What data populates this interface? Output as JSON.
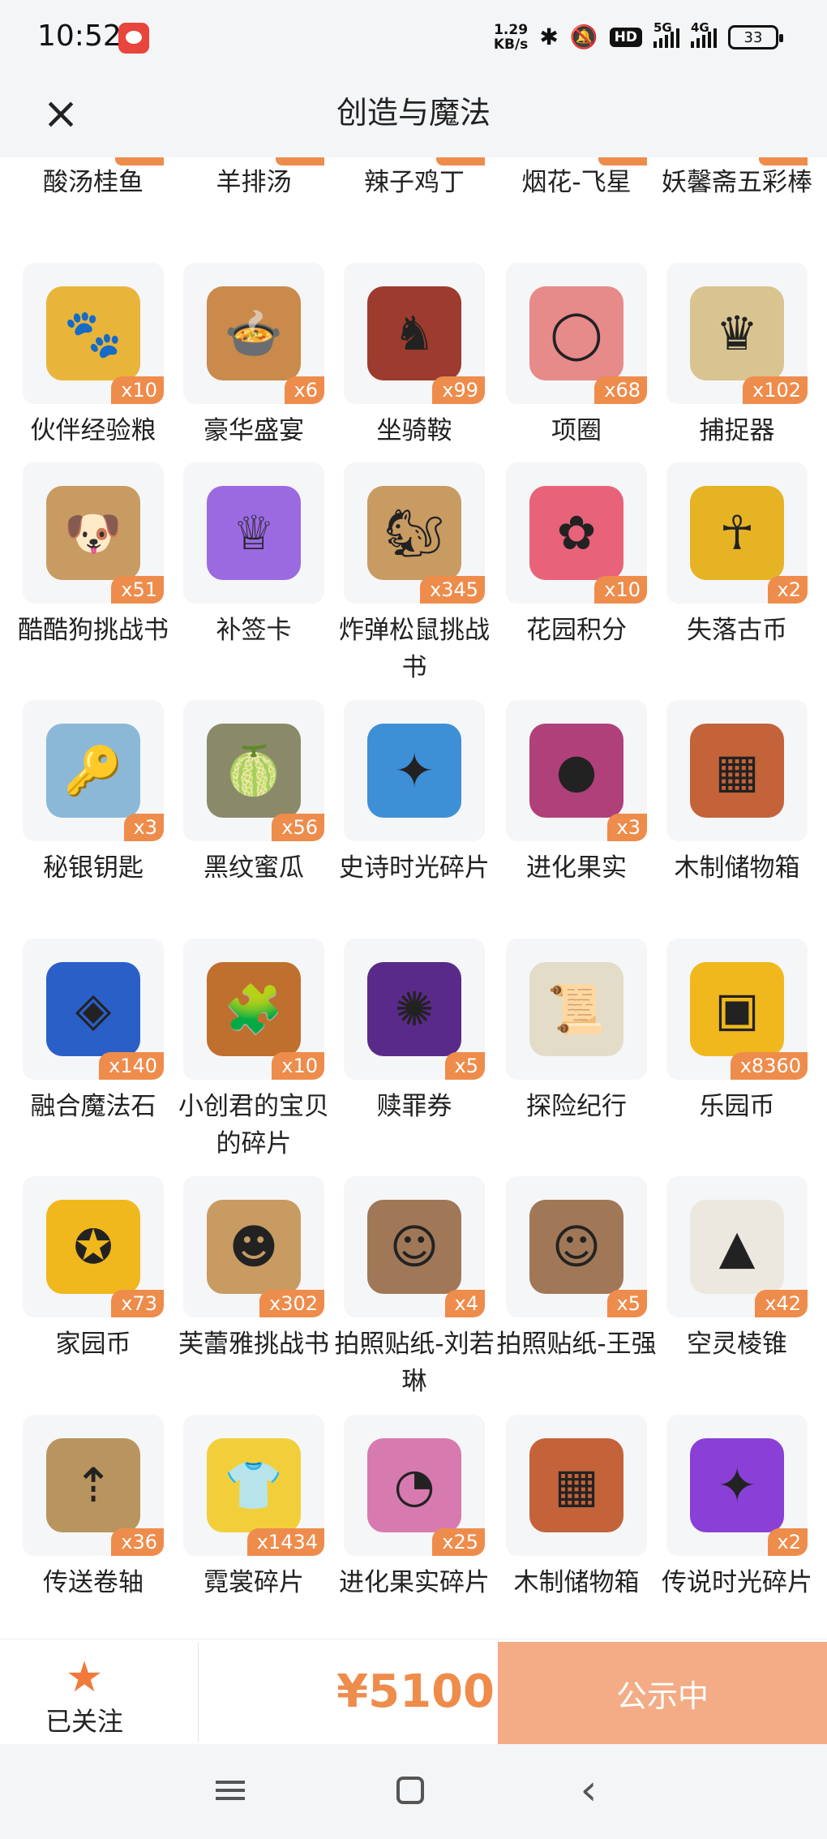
{
  "status_bar": {
    "time": "10:52",
    "net_speed_value": "1.29",
    "net_speed_unit": "KB/s",
    "hd_label": "HD",
    "signal1_label": "5G",
    "signal2_label": "4G",
    "battery": "33"
  },
  "header": {
    "title": "创造与魔法",
    "close_icon": "×"
  },
  "cut_row": [
    {
      "name": "酸汤桂鱼"
    },
    {
      "name": "羊排汤"
    },
    {
      "name": "辣子鸡丁"
    },
    {
      "name": "烟花-飞星"
    },
    {
      "name": "妖馨斋五彩棒"
    }
  ],
  "items": [
    {
      "name": "伙伴经验粮",
      "count": "x10",
      "icon": "paw-bag-icon",
      "color": "#e8b53a",
      "glyph": "🐾"
    },
    {
      "name": "豪华盛宴",
      "count": "x6",
      "icon": "feast-bowl-icon",
      "color": "#c98a4b",
      "glyph": "🍲"
    },
    {
      "name": "坐骑鞍",
      "count": "x99",
      "icon": "saddle-icon",
      "color": "#9c3b2e",
      "glyph": "♞"
    },
    {
      "name": "项圈",
      "count": "x68",
      "icon": "collar-icon",
      "color": "#e78a8a",
      "glyph": "◯"
    },
    {
      "name": "捕捉器",
      "count": "x102",
      "icon": "catcher-icon",
      "color": "#d9c491",
      "glyph": "♛"
    },
    {
      "name": "酷酷狗挑战书",
      "count": "x51",
      "icon": "wanted-poster-dog-icon",
      "color": "#c89b62",
      "glyph": "🐶"
    },
    {
      "name": "补签卡",
      "count": "",
      "icon": "sign-card-icon",
      "color": "#9b6ae0",
      "glyph": "♕"
    },
    {
      "name": "炸弹松鼠挑战书",
      "count": "x345",
      "icon": "wanted-poster-squirrel-icon",
      "color": "#c89b62",
      "glyph": "🐿"
    },
    {
      "name": "花园积分",
      "count": "x10",
      "icon": "flower-icon",
      "color": "#e8637a",
      "glyph": "✿"
    },
    {
      "name": "失落古币",
      "count": "x2",
      "icon": "ancient-coin-icon",
      "color": "#e6b325",
      "glyph": "☥"
    },
    {
      "name": "秘银钥匙",
      "count": "x3",
      "icon": "key-icon",
      "color": "#8cb8d8",
      "glyph": "🔑"
    },
    {
      "name": "黑纹蜜瓜",
      "count": "x56",
      "icon": "melon-icon",
      "color": "#8a8a6a",
      "glyph": "🍈"
    },
    {
      "name": "史诗时光碎片",
      "count": "",
      "icon": "blue-puzzle-piece-icon",
      "color": "#3d8fd6",
      "glyph": "✦"
    },
    {
      "name": "进化果实",
      "count": "x3",
      "icon": "evolution-fruit-icon",
      "color": "#b0407a",
      "glyph": "●"
    },
    {
      "name": "木制储物箱",
      "count": "",
      "icon": "wooden-crate-icon",
      "color": "#c4623a",
      "glyph": "▦"
    },
    {
      "name": "融合魔法石",
      "count": "x140",
      "icon": "magic-stone-icon",
      "color": "#2b5fc8",
      "glyph": "◈"
    },
    {
      "name": "小创君的宝贝的碎片",
      "count": "x10",
      "icon": "puzzle-fragment-icon",
      "color": "#c0702e",
      "glyph": "🧩"
    },
    {
      "name": "赎罪券",
      "count": "x5",
      "icon": "atonement-ticket-icon",
      "color": "#5a2a8a",
      "glyph": "✺"
    },
    {
      "name": "探险纪行",
      "count": "",
      "icon": "scroll-icon",
      "color": "#e2dcc8",
      "glyph": "📜"
    },
    {
      "name": "乐园币",
      "count": "x8360",
      "icon": "paradise-coin-icon",
      "color": "#f0b81c",
      "glyph": "▣"
    },
    {
      "name": "家园币",
      "count": "x73",
      "icon": "home-coin-icon",
      "color": "#f0b81c",
      "glyph": "✪"
    },
    {
      "name": "芙蕾雅挑战书",
      "count": "x302",
      "icon": "wanted-poster-freya-icon",
      "color": "#c89b62",
      "glyph": "☻"
    },
    {
      "name": "拍照贴纸-刘若琳",
      "count": "x4",
      "icon": "photo-sticker-icon",
      "color": "#a07858",
      "glyph": "☺"
    },
    {
      "name": "拍照贴纸-王强",
      "count": "x5",
      "icon": "photo-sticker-icon",
      "color": "#a07858",
      "glyph": "☺"
    },
    {
      "name": "空灵棱锥",
      "count": "x42",
      "icon": "pyramid-icon",
      "color": "#ece8e0",
      "glyph": "▲"
    },
    {
      "name": "传送卷轴",
      "count": "x36",
      "icon": "teleport-scroll-icon",
      "color": "#b8955e",
      "glyph": "⇡"
    },
    {
      "name": "霓裳碎片",
      "count": "x1434",
      "icon": "shirt-icon",
      "color": "#f2cf3a",
      "glyph": "👕"
    },
    {
      "name": "进化果实碎片",
      "count": "x25",
      "icon": "fruit-slice-icon",
      "color": "#d77ab0",
      "glyph": "◔"
    },
    {
      "name": "木制储物箱",
      "count": "",
      "icon": "wooden-crate-icon",
      "color": "#c4623a",
      "glyph": "▦"
    },
    {
      "name": "传说时光碎片",
      "count": "x2",
      "icon": "purple-puzzle-piece-icon",
      "color": "#8a3fd6",
      "glyph": "✦"
    }
  ],
  "bottom": {
    "follow_label": "已关注",
    "star_glyph": "★",
    "price": "¥5100",
    "status_label": "公示中"
  },
  "colors": {
    "accent": "#ee8c4c",
    "button": "#f3ac85",
    "card_bg": "#f5f6f8"
  }
}
